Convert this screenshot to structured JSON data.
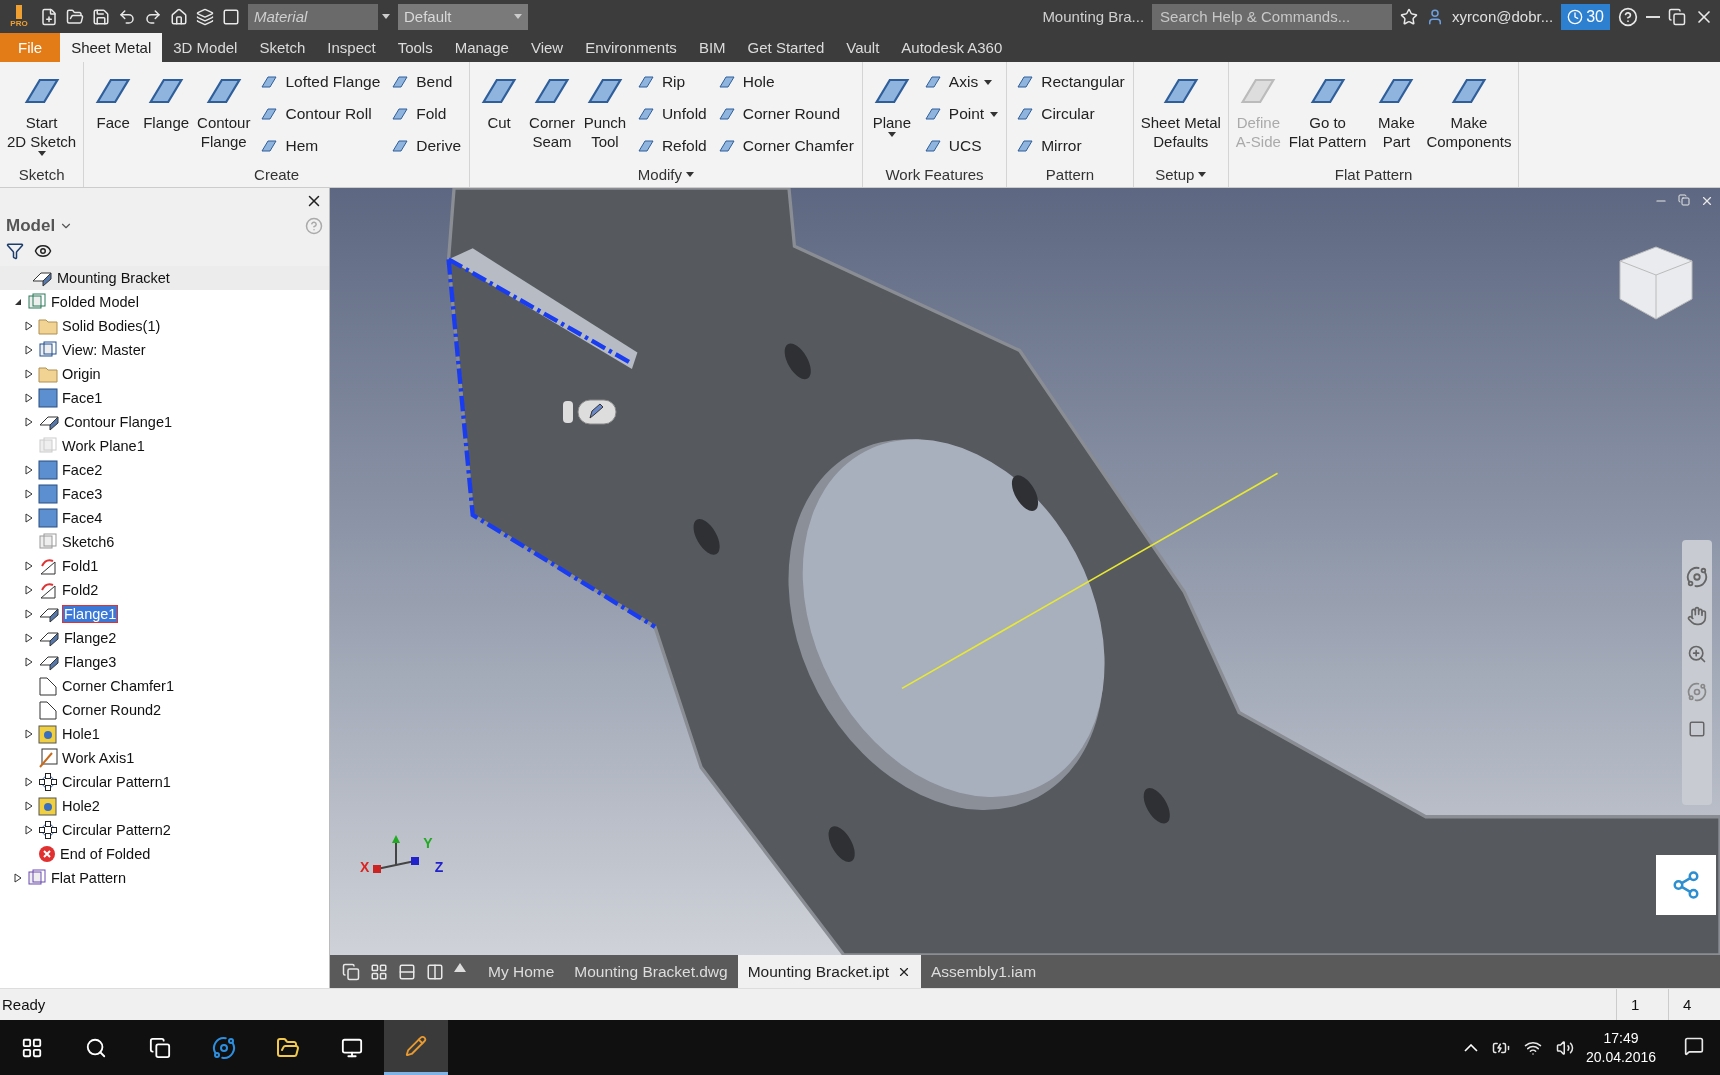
{
  "title_bar": {
    "app_badge": "PRO",
    "material": {
      "placeholder": "Material"
    },
    "appearance": {
      "value": "Default"
    },
    "document_title": "Mounting Bra...",
    "search": {
      "placeholder": "Search Help & Commands..."
    },
    "user": "xyrcon@dobr...",
    "trial_days": "30"
  },
  "tabs": [
    {
      "label": "File",
      "kind": "file",
      "selected": false
    },
    {
      "label": "Sheet Metal",
      "kind": "tab",
      "selected": true
    },
    {
      "label": "3D Model",
      "kind": "tab",
      "selected": false
    },
    {
      "label": "Sketch",
      "kind": "tab",
      "selected": false
    },
    {
      "label": "Inspect",
      "kind": "tab",
      "selected": false
    },
    {
      "label": "Tools",
      "kind": "tab",
      "selected": false
    },
    {
      "label": "Manage",
      "kind": "tab",
      "selected": false
    },
    {
      "label": "View",
      "kind": "tab",
      "selected": false
    },
    {
      "label": "Environments",
      "kind": "tab",
      "selected": false
    },
    {
      "label": "BIM",
      "kind": "tab",
      "selected": false
    },
    {
      "label": "Get Started",
      "kind": "tab",
      "selected": false
    },
    {
      "label": "Vault",
      "kind": "tab",
      "selected": false
    },
    {
      "label": "Autodesk A360",
      "kind": "tab",
      "selected": false
    }
  ],
  "ribbon": [
    {
      "title": "Sketch",
      "title_menu": false,
      "items": [
        {
          "label": "Start\n2D Sketch",
          "kind": "large-split",
          "disabled": false
        }
      ]
    },
    {
      "title": "Create",
      "title_menu": false,
      "items": [
        {
          "label": "Face",
          "kind": "large",
          "disabled": false
        },
        {
          "label": "Flange",
          "kind": "large",
          "disabled": false
        },
        {
          "label": "Contour\nFlange",
          "kind": "large",
          "disabled": false
        },
        {
          "label": "Lofted Flange",
          "kind": "small",
          "disabled": false
        },
        {
          "label": "Contour Roll",
          "kind": "small",
          "disabled": false
        },
        {
          "label": "Hem",
          "kind": "small",
          "disabled": false
        },
        {
          "label": "Bend",
          "kind": "small",
          "disabled": false
        },
        {
          "label": "Fold",
          "kind": "small",
          "disabled": false
        },
        {
          "label": "Derive",
          "kind": "small",
          "disabled": false
        }
      ]
    },
    {
      "title": "Modify",
      "title_menu": true,
      "items": [
        {
          "label": "Cut",
          "kind": "large",
          "disabled": false
        },
        {
          "label": "Corner\nSeam",
          "kind": "large",
          "disabled": false
        },
        {
          "label": "Punch\nTool",
          "kind": "large",
          "disabled": false
        },
        {
          "label": "Rip",
          "kind": "small",
          "disabled": false
        },
        {
          "label": "Unfold",
          "kind": "small",
          "disabled": false
        },
        {
          "label": "Refold",
          "kind": "small",
          "disabled": false
        },
        {
          "label": "Hole",
          "kind": "small",
          "disabled": false
        },
        {
          "label": "Corner Round",
          "kind": "small",
          "disabled": false
        },
        {
          "label": "Corner Chamfer",
          "kind": "small",
          "disabled": false
        }
      ]
    },
    {
      "title": "Work Features",
      "title_menu": false,
      "items": [
        {
          "label": "Plane",
          "kind": "large-split",
          "disabled": false
        },
        {
          "label": "Axis",
          "kind": "small-split",
          "disabled": false
        },
        {
          "label": "Point",
          "kind": "small-split",
          "disabled": false
        },
        {
          "label": "UCS",
          "kind": "small",
          "disabled": false
        }
      ]
    },
    {
      "title": "Pattern",
      "title_menu": false,
      "items": [
        {
          "label": "Rectangular",
          "kind": "small",
          "disabled": false
        },
        {
          "label": "Circular",
          "kind": "small",
          "disabled": false
        },
        {
          "label": "Mirror",
          "kind": "small",
          "disabled": false
        }
      ]
    },
    {
      "title": "Setup",
      "title_menu": true,
      "items": [
        {
          "label": "Sheet Metal\nDefaults",
          "kind": "large",
          "disabled": false
        }
      ]
    },
    {
      "title": "Flat Pattern",
      "title_menu": false,
      "items": [
        {
          "label": "Define\nA-Side",
          "kind": "large",
          "disabled": true
        },
        {
          "label": "Go to\nFlat Pattern",
          "kind": "large",
          "disabled": false
        },
        {
          "label": "Make\nPart",
          "kind": "large",
          "disabled": false
        },
        {
          "label": "Make\nComponents",
          "kind": "large",
          "disabled": false
        }
      ]
    }
  ],
  "model_browser": {
    "title": "Model",
    "tree": [
      {
        "label": "Mounting Bracket",
        "kind": "part",
        "selected": false,
        "children": [
          {
            "label": "Folded Model",
            "kind": "model",
            "expanded": true,
            "selected": false,
            "children": [
              {
                "label": "Solid Bodies(1)",
                "kind": "folder",
                "expanded": false,
                "selected": false
              },
              {
                "label": "View: Master",
                "kind": "view",
                "expanded": false,
                "selected": false
              },
              {
                "label": "Origin",
                "kind": "folder",
                "expanded": false,
                "selected": false
              },
              {
                "label": "Face1",
                "kind": "face",
                "expanded": false,
                "selected": false
              },
              {
                "label": "Contour Flange1",
                "kind": "flange",
                "expanded": false,
                "selected": false
              },
              {
                "label": "Work Plane1",
                "kind": "plane",
                "selected": false
              },
              {
                "label": "Face2",
                "kind": "face",
                "expanded": false,
                "selected": false
              },
              {
                "label": "Face3",
                "kind": "face",
                "expanded": false,
                "selected": false
              },
              {
                "label": "Face4",
                "kind": "face",
                "expanded": false,
                "selected": false
              },
              {
                "label": "Sketch6",
                "kind": "sketch",
                "selected": false
              },
              {
                "label": "Fold1",
                "kind": "fold",
                "expanded": false,
                "selected": false
              },
              {
                "label": "Fold2",
                "kind": "fold",
                "expanded": false,
                "selected": false
              },
              {
                "label": "Flange1",
                "kind": "flange",
                "expanded": false,
                "selected": true
              },
              {
                "label": "Flange2",
                "kind": "flange",
                "expanded": false,
                "selected": false
              },
              {
                "label": "Flange3",
                "kind": "flange",
                "expanded": false,
                "selected": false
              },
              {
                "label": "Corner Chamfer1",
                "kind": "corner",
                "selected": false
              },
              {
                "label": "Corner Round2",
                "kind": "corner",
                "selected": false
              },
              {
                "label": "Hole1",
                "kind": "hole",
                "expanded": false,
                "selected": false
              },
              {
                "label": "Work Axis1",
                "kind": "axis",
                "selected": false
              },
              {
                "label": "Circular Pattern1",
                "kind": "pattern",
                "expanded": false,
                "selected": false
              },
              {
                "label": "Hole2",
                "kind": "hole",
                "expanded": false,
                "selected": false
              },
              {
                "label": "Circular Pattern2",
                "kind": "pattern",
                "expanded": false,
                "selected": false
              },
              {
                "label": "End of Folded",
                "kind": "end",
                "selected": false
              }
            ]
          },
          {
            "label": "Flat Pattern",
            "kind": "flat",
            "expanded": false,
            "selected": false
          }
        ]
      }
    ]
  },
  "viewport": {
    "triad": [
      "X",
      "Y",
      "Z"
    ]
  },
  "document_tabs": [
    {
      "label": "My Home",
      "selected": false
    },
    {
      "label": "Mounting Bracket.dwg",
      "selected": false
    },
    {
      "label": "Mounting Bracket.ipt",
      "selected": true
    },
    {
      "label": "Assembly1.iam",
      "selected": false
    }
  ],
  "status_bar": {
    "message": "Ready",
    "field_1": "1",
    "field_2": "4"
  },
  "taskbar": {
    "time": "17:49",
    "date": "20.04.2016"
  }
}
